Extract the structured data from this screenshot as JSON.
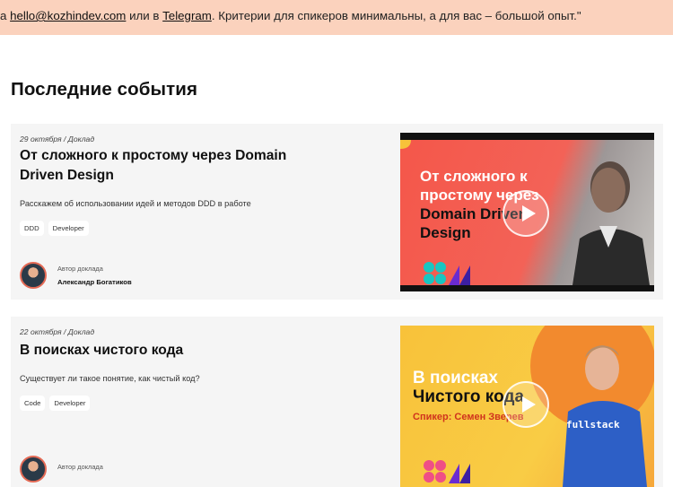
{
  "banner": {
    "pre": "а ",
    "email": "hello@kozhindev.com",
    "mid": " или в ",
    "telegram": "Telegram",
    "post": ". Критерии для спикеров минимальны, а для вас – большой опыт.\""
  },
  "section_title": "Последние события",
  "events": [
    {
      "meta": "29 октября / Доклад",
      "title": "От сложного к простому через Domain Driven Design",
      "description": "Расскажем об использовании идей и методов DDD в работе",
      "tags": [
        "DDD",
        "Developer"
      ],
      "author_caption": "Автор доклада",
      "author_name": "Александр Богатиков",
      "thumb_lines": [
        "От сложного к",
        "простому через",
        "Domain Driven",
        "Design"
      ]
    },
    {
      "meta": "22 октября / Доклад",
      "title": "В поисках чистого кода",
      "description": "Существует ли такое понятие, как чистый код?",
      "tags": [
        "Code",
        "Developer"
      ],
      "author_caption": "Автор доклада",
      "author_name": "",
      "thumb_lines": [
        "В поисках",
        "Чистого кода"
      ],
      "thumb_speaker": "Спикер: Семен Зверев",
      "shirt_text": "fullstack"
    }
  ],
  "colors": {
    "banner_bg": "#fbd2bd",
    "card_bg": "#f5f5f5",
    "thumb1_bg": "#f4574a",
    "thumb2_bg": "#f8c23a",
    "accent_red": "#d0331d"
  },
  "icons": [
    "play-icon",
    "avatar"
  ]
}
